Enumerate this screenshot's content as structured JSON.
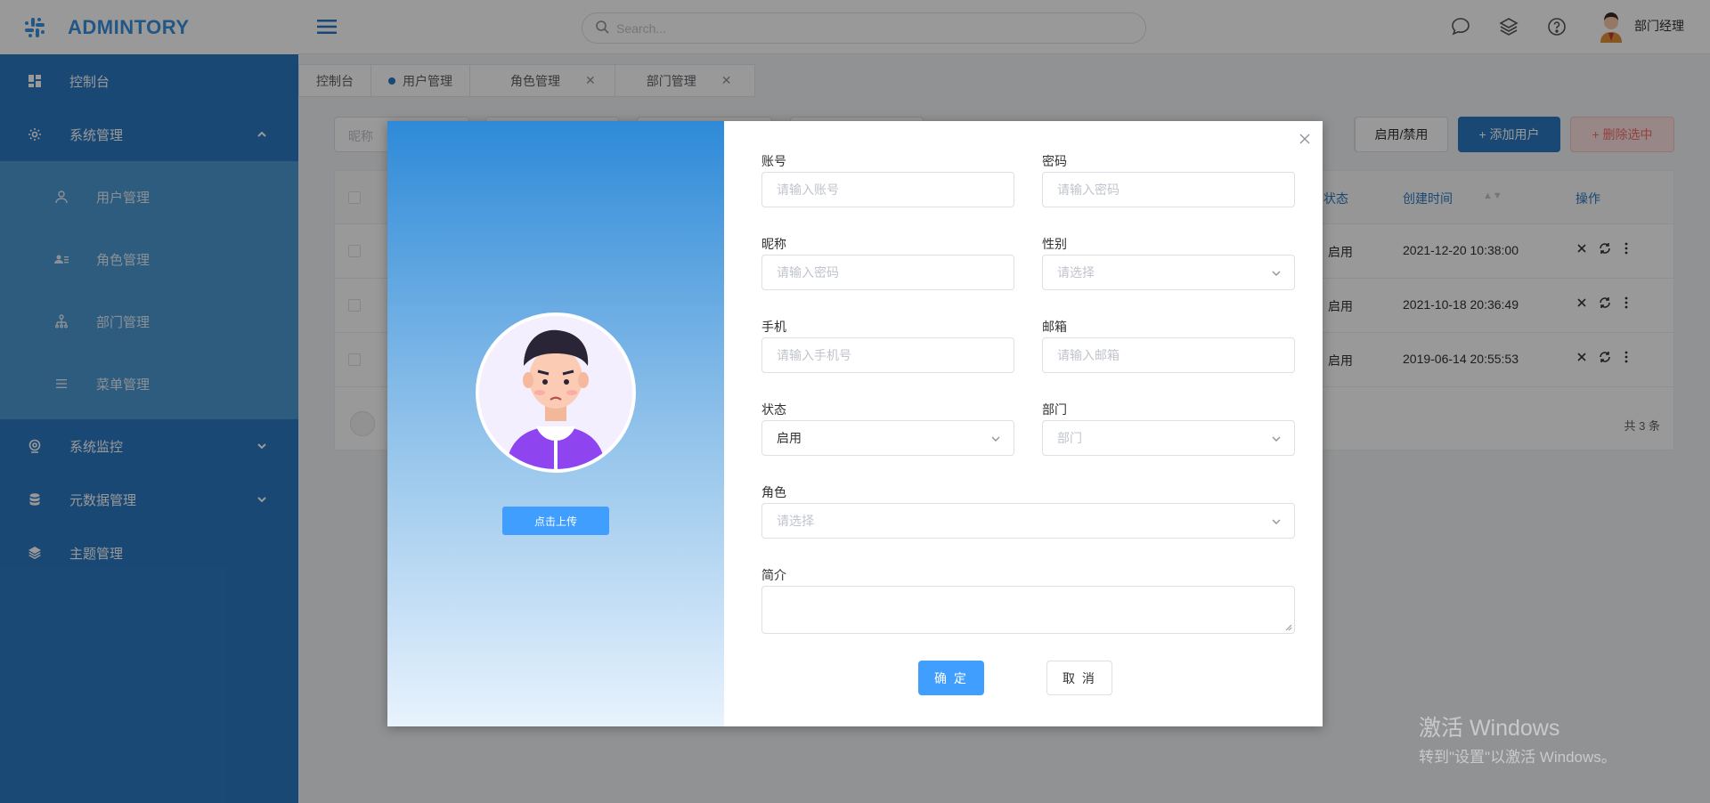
{
  "app": {
    "logo_text": "ADMINTORY"
  },
  "sidebar": {
    "items": [
      {
        "label": "控制台",
        "icon": "dashboard-icon"
      },
      {
        "label": "系统管理",
        "icon": "gear-icon",
        "expanded": true,
        "children": [
          {
            "label": "用户管理",
            "icon": "user-icon"
          },
          {
            "label": "角色管理",
            "icon": "role-icon"
          },
          {
            "label": "部门管理",
            "icon": "org-tree-icon"
          },
          {
            "label": "菜单管理",
            "icon": "list-icon"
          }
        ]
      },
      {
        "label": "系统监控",
        "icon": "monitor-icon"
      },
      {
        "label": "元数据管理",
        "icon": "database-icon"
      },
      {
        "label": "主题管理",
        "icon": "layers-icon"
      }
    ]
  },
  "header": {
    "search_placeholder": "Search...",
    "user_name": "部门经理"
  },
  "tabs": [
    {
      "label": "控制台"
    },
    {
      "label": "用户管理",
      "active": true
    },
    {
      "label": "角色管理",
      "closable": true
    },
    {
      "label": "部门管理",
      "closable": true
    }
  ],
  "toolbar": {
    "filter1_placeholder": "昵称",
    "toggle_label": "启用/禁用",
    "add_label": "+ 添加用户",
    "delete_label": "+ 删除选中"
  },
  "table": {
    "headers": {
      "status": "状态",
      "created": "创建时间",
      "actions": "操作"
    },
    "rows": [
      {
        "status": "启用",
        "created": "2021-12-20 10:38:00"
      },
      {
        "status": "启用",
        "created": "2021-10-18 20:36:49"
      },
      {
        "status": "启用",
        "created": "2019-06-14 20:55:53"
      }
    ],
    "total": "共 3 条"
  },
  "dialog": {
    "upload_label": "点击上传",
    "fields": {
      "account": {
        "label": "账号",
        "placeholder": "请输入账号"
      },
      "password": {
        "label": "密码",
        "placeholder": "请输入密码"
      },
      "nickname": {
        "label": "昵称",
        "placeholder": "请输入密码"
      },
      "gender": {
        "label": "性别",
        "placeholder": "请选择"
      },
      "phone": {
        "label": "手机",
        "placeholder": "请输入手机号"
      },
      "email": {
        "label": "邮箱",
        "placeholder": "请输入邮箱"
      },
      "status": {
        "label": "状态",
        "value": "启用"
      },
      "department": {
        "label": "部门",
        "placeholder": "部门"
      },
      "role": {
        "label": "角色",
        "placeholder": "请选择"
      },
      "bio": {
        "label": "简介"
      }
    },
    "ok_label": "确 定",
    "cancel_label": "取 消"
  },
  "watermark": {
    "line1": "激活 Windows",
    "line2": "转到\"设置\"以激活 Windows。"
  },
  "colors": {
    "sidebar": "#2a79c2",
    "submenu": "#4c99d3",
    "primary": "#409eff",
    "brand": "#3a8fde"
  }
}
